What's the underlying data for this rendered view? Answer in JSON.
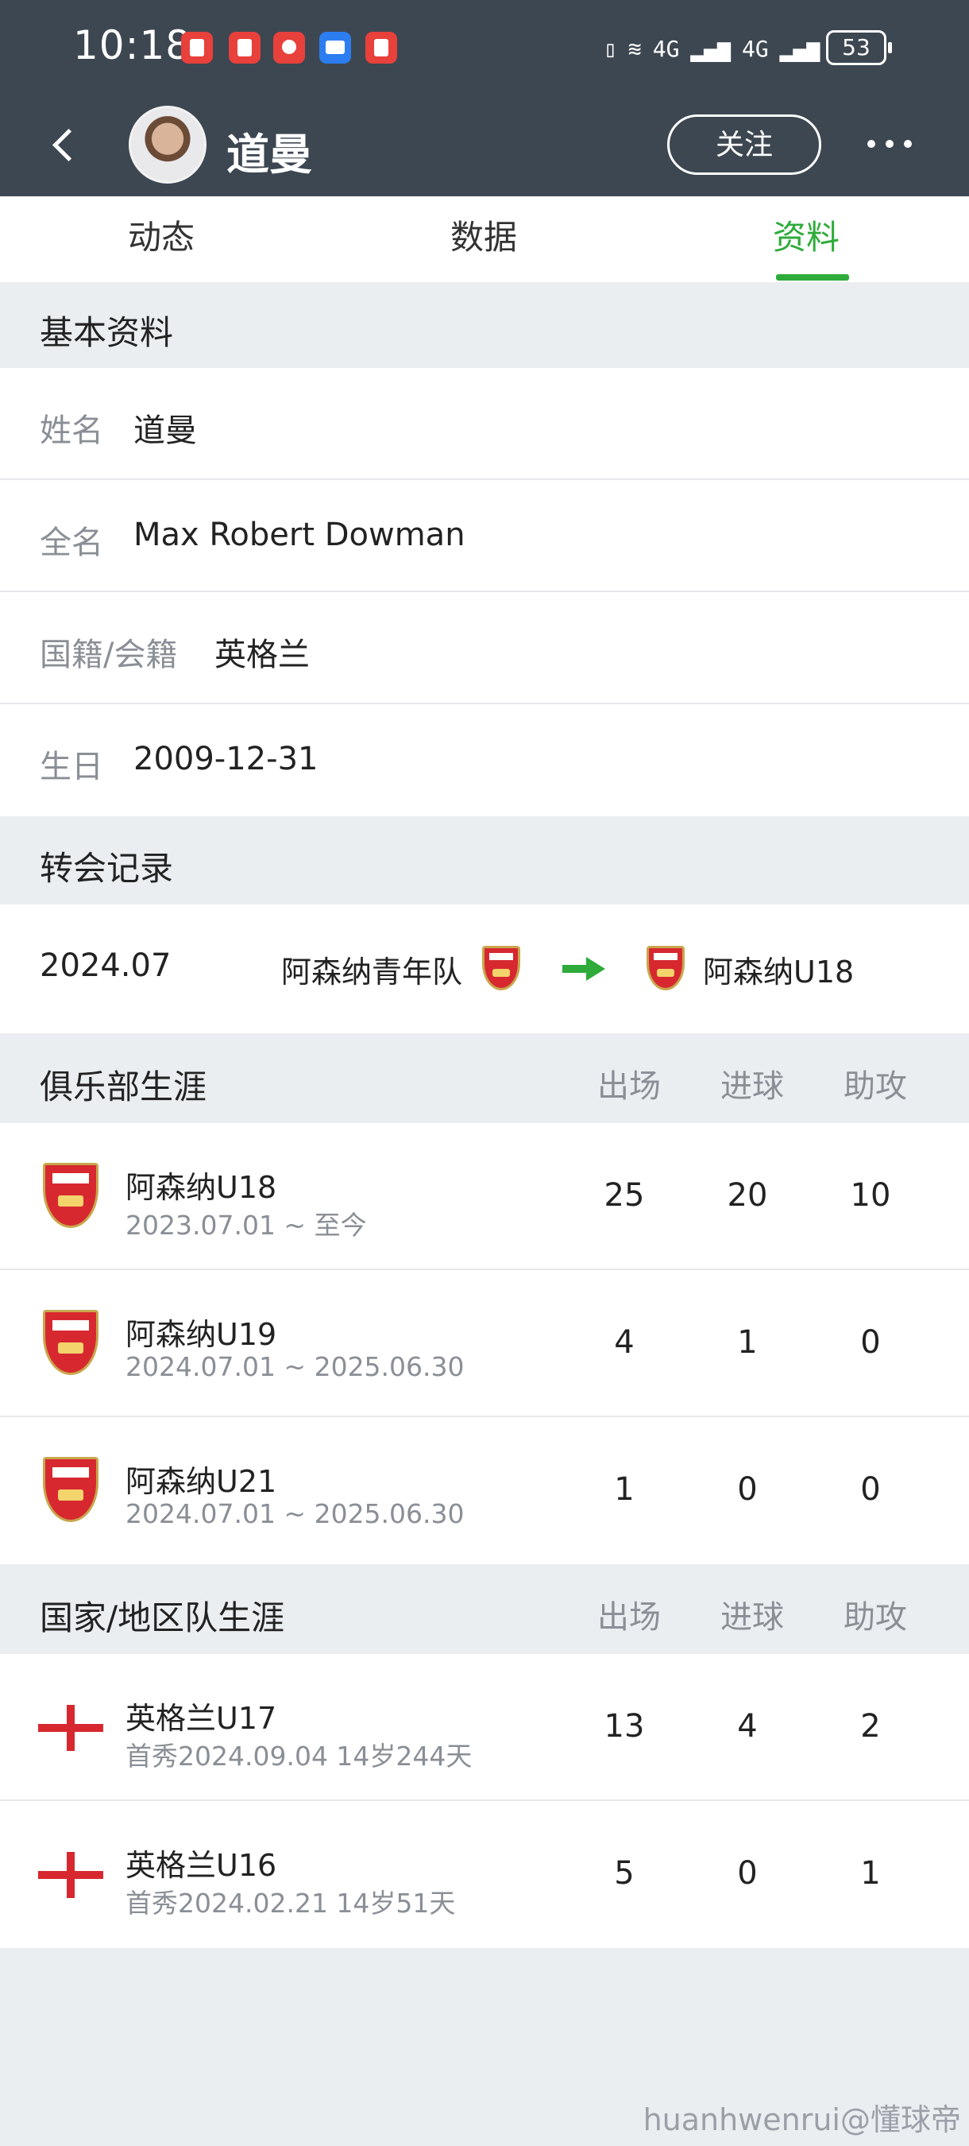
{
  "status_bar": {
    "time": "10:18",
    "signal_1": "4G",
    "signal_2": "4G",
    "battery": "53"
  },
  "header": {
    "player_name": "道曼",
    "follow_label": "关注"
  },
  "tabs": [
    {
      "label": "动态",
      "active": false
    },
    {
      "label": "数据",
      "active": false
    },
    {
      "label": "资料",
      "active": true
    }
  ],
  "basic_info": {
    "section_title": "基本资料",
    "rows": [
      {
        "key": "姓名",
        "value": "道曼"
      },
      {
        "key": "全名",
        "value": "Max Robert Dowman"
      },
      {
        "key": "国籍/会籍",
        "value": "英格兰"
      },
      {
        "key": "生日",
        "value": "2009-12-31"
      }
    ]
  },
  "transfer": {
    "section_title": "转会记录",
    "date": "2024.07",
    "from_team": "阿森纳青年队",
    "to_team": "阿森纳U18"
  },
  "club_career": {
    "section_title": "俱乐部生涯",
    "columns": [
      "出场",
      "进球",
      "助攻"
    ],
    "rows": [
      {
        "team": "阿森纳U18",
        "period": "2023.07.01 ~ 至今",
        "apps": "25",
        "goals": "20",
        "assists": "10"
      },
      {
        "team": "阿森纳U19",
        "period": "2024.07.01 ~ 2025.06.30",
        "apps": "4",
        "goals": "1",
        "assists": "0"
      },
      {
        "team": "阿森纳U21",
        "period": "2024.07.01 ~ 2025.06.30",
        "apps": "1",
        "goals": "0",
        "assists": "0"
      }
    ]
  },
  "national_career": {
    "section_title": "国家/地区队生涯",
    "columns": [
      "出场",
      "进球",
      "助攻"
    ],
    "rows": [
      {
        "team": "英格兰U17",
        "period": "首秀2024.09.04 14岁244天",
        "apps": "13",
        "goals": "4",
        "assists": "2"
      },
      {
        "team": "英格兰U16",
        "period": "首秀2024.02.21 14岁51天",
        "apps": "5",
        "goals": "0",
        "assists": "1"
      }
    ]
  },
  "watermark": "huanhwenrui@懂球帝",
  "colors": {
    "header_bg": "#3d4751",
    "accent_green": "#2eab3a",
    "section_bg": "#ebeef1"
  }
}
